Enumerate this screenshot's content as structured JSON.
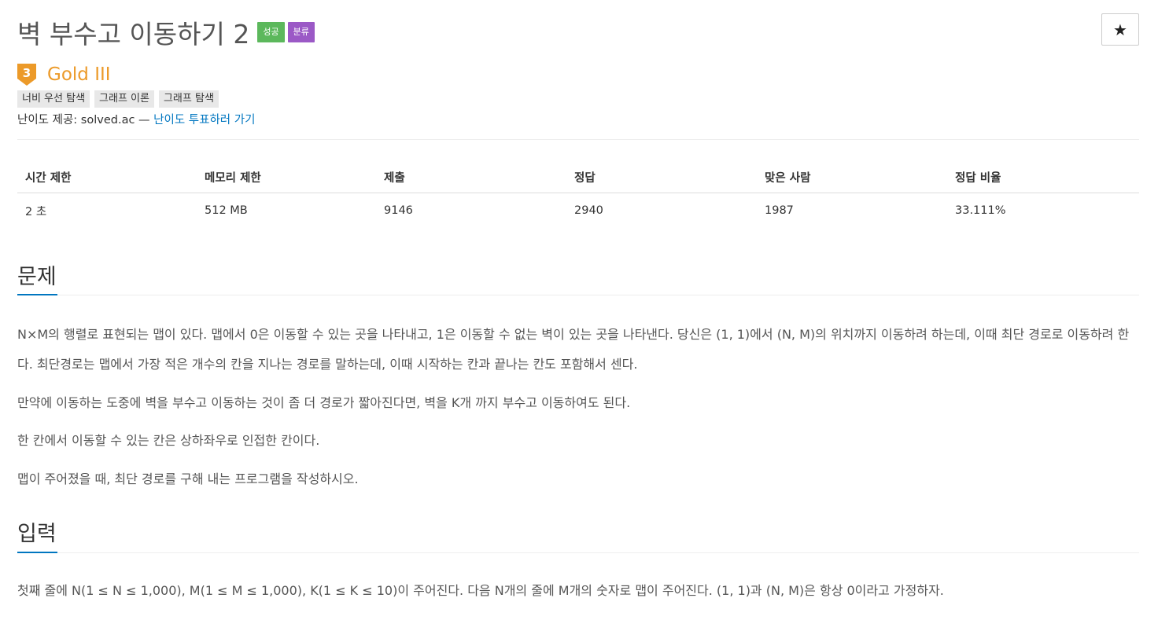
{
  "problem": {
    "title": "벽 부수고 이동하기 2",
    "badges": [
      {
        "label": "성공",
        "color": "#5cb85c"
      },
      {
        "label": "분류",
        "color": "#9b59c6"
      }
    ],
    "star_button": "★"
  },
  "tier": {
    "number": "3",
    "label": "Gold III",
    "color": "#ec9a29"
  },
  "tags": [
    "너비 우선 탐색",
    "그래프 이론",
    "그래프 탐색"
  ],
  "credit": {
    "text": "난이도 제공: solved.ac — ",
    "link": "난이도 투표하러 가기"
  },
  "stats": {
    "headers": [
      "시간 제한",
      "메모리 제한",
      "제출",
      "정답",
      "맞은 사람",
      "정답 비율"
    ],
    "values": [
      "2 초",
      "512 MB",
      "9146",
      "2940",
      "1987",
      "33.111%"
    ]
  },
  "sections": {
    "problem_heading": "문제",
    "problem_paragraphs": [
      "N×M의 행렬로 표현되는 맵이 있다. 맵에서 0은 이동할 수 있는 곳을 나타내고, 1은 이동할 수 없는 벽이 있는 곳을 나타낸다. 당신은 (1, 1)에서 (N, M)의 위치까지 이동하려 하는데, 이때 최단 경로로 이동하려 한다. 최단경로는 맵에서 가장 적은 개수의 칸을 지나는 경로를 말하는데, 이때 시작하는 칸과 끝나는 칸도 포함해서 센다.",
      "만약에 이동하는 도중에 벽을 부수고 이동하는 것이 좀 더 경로가 짧아진다면, 벽을 K개 까지 부수고 이동하여도 된다.",
      "한 칸에서 이동할 수 있는 칸은 상하좌우로 인접한 칸이다.",
      "맵이 주어졌을 때, 최단 경로를 구해 내는 프로그램을 작성하시오."
    ],
    "input_heading": "입력",
    "input_paragraph": "첫째 줄에 N(1 ≤ N ≤ 1,000), M(1 ≤ M ≤ 1,000), K(1 ≤ K ≤ 10)이 주어진다. 다음 N개의 줄에 M개의 숫자로 맵이 주어진다. (1, 1)과 (N, M)은 항상 0이라고 가정하자."
  }
}
